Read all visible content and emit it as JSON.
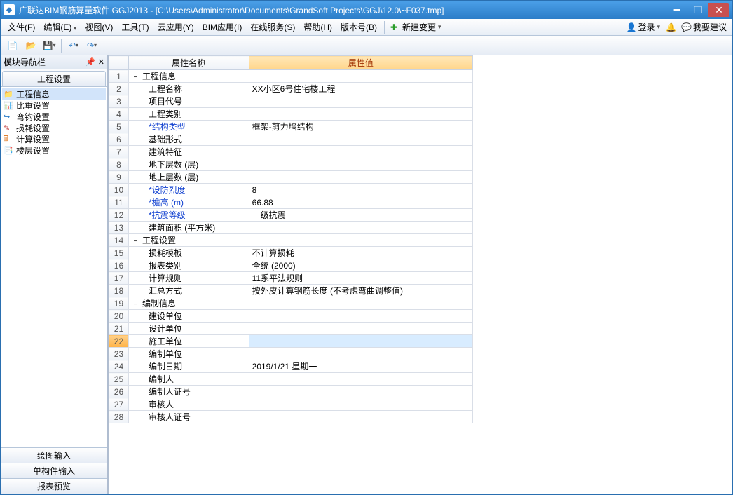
{
  "title": "广联达BIM钢筋算量软件 GGJ2013 - [C:\\Users\\Administrator\\Documents\\GrandSoft Projects\\GGJ\\12.0\\~F037.tmp]",
  "menus": {
    "file": "文件(F)",
    "edit": "编辑(E)",
    "view": "视图(V)",
    "tool": "工具(T)",
    "cloud": "云应用(Y)",
    "bim": "BIM应用(I)",
    "online": "在线服务(S)",
    "help": "帮助(H)",
    "version": "版本号(B)",
    "newchange": "新建变更",
    "login": "登录",
    "suggest": "我要建议"
  },
  "nav": {
    "header": "模块导航栏",
    "tab": "工程设置",
    "items": [
      {
        "icon": "📁",
        "cls": "ico-orange",
        "label": "工程信息"
      },
      {
        "icon": "📊",
        "cls": "ico-red",
        "label": "比重设置"
      },
      {
        "icon": "↪",
        "cls": "ico-blue",
        "label": "弯钩设置"
      },
      {
        "icon": "✎",
        "cls": "ico-red",
        "label": "损耗设置"
      },
      {
        "icon": "🖩",
        "cls": "ico-orange",
        "label": "计算设置"
      },
      {
        "icon": "📑",
        "cls": "ico-blue",
        "label": "楼层设置"
      }
    ],
    "bottom": [
      "绘图输入",
      "单构件输入",
      "报表预览"
    ]
  },
  "grid": {
    "col_name": "属性名称",
    "col_value": "属性值",
    "rows": [
      {
        "n": 1,
        "group": true,
        "label": "工程信息",
        "value": ""
      },
      {
        "n": 2,
        "label": "工程名称",
        "value": "XX小区6号住宅楼工程"
      },
      {
        "n": 3,
        "label": "项目代号",
        "value": ""
      },
      {
        "n": 4,
        "label": "工程类别",
        "value": ""
      },
      {
        "n": 5,
        "label": "*结构类型",
        "req": true,
        "value": "框架-剪力墙结构"
      },
      {
        "n": 6,
        "label": "基础形式",
        "value": ""
      },
      {
        "n": 7,
        "label": "建筑特征",
        "value": ""
      },
      {
        "n": 8,
        "label": "地下层数 (层)",
        "value": ""
      },
      {
        "n": 9,
        "label": "地上层数 (层)",
        "value": ""
      },
      {
        "n": 10,
        "label": "*设防烈度",
        "req": true,
        "value": "8"
      },
      {
        "n": 11,
        "label": "*檐高 (m)",
        "req": true,
        "value": "66.88"
      },
      {
        "n": 12,
        "label": "*抗震等级",
        "req": true,
        "value": "一级抗震"
      },
      {
        "n": 13,
        "label": "建筑面积 (平方米)",
        "value": ""
      },
      {
        "n": 14,
        "group": true,
        "label": "工程设置",
        "value": ""
      },
      {
        "n": 15,
        "label": "损耗模板",
        "value": "不计算损耗"
      },
      {
        "n": 16,
        "label": "报表类别",
        "value": "全统 (2000)"
      },
      {
        "n": 17,
        "label": "计算规则",
        "value": "11系平法规则"
      },
      {
        "n": 18,
        "label": "汇总方式",
        "value": "按外皮计算钢筋长度 (不考虑弯曲调整值)"
      },
      {
        "n": 19,
        "group": true,
        "label": "编制信息",
        "value": ""
      },
      {
        "n": 20,
        "label": "建设单位",
        "value": ""
      },
      {
        "n": 21,
        "label": "设计单位",
        "value": ""
      },
      {
        "n": 22,
        "label": "施工单位",
        "value": "",
        "selected": true
      },
      {
        "n": 23,
        "label": "编制单位",
        "value": ""
      },
      {
        "n": 24,
        "label": "编制日期",
        "value": "2019/1/21 星期一"
      },
      {
        "n": 25,
        "label": "编制人",
        "value": ""
      },
      {
        "n": 26,
        "label": "编制人证号",
        "value": ""
      },
      {
        "n": 27,
        "label": "审核人",
        "value": ""
      },
      {
        "n": 28,
        "label": "审核人证号",
        "value": ""
      }
    ]
  }
}
